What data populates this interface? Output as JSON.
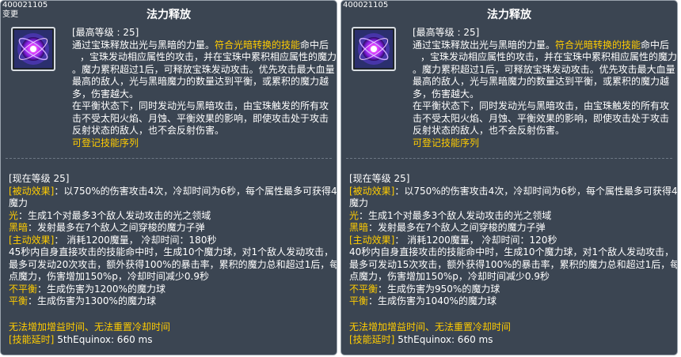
{
  "left": {
    "skill_id": "400021105",
    "changed_label": "变更",
    "title": "法力释放",
    "icon": "mana-orb-icon",
    "desc": {
      "max_level": "[最高等级 : 25]",
      "p1_a": "通过宝珠释放出光与黑暗的力量。",
      "p1_hl": "符合光暗转换的技能",
      "p1_b": "命中后",
      "l2": "，宝珠发动相应属性的攻击，并在宝珠中累积相应属性的魔力",
      "l3": "。魔力累积超过1后，可释放宝珠发动攻击。优先攻击最大血量",
      "l4": "最高的敌人，光与黑暗魔力的数量达到平衡，或累积的魔力越",
      "l5": "多，伤害越大。",
      "l6": "在平衡状态下，同时发动光与黑暗攻击，由宝珠触发的所有攻",
      "l7": "击不受太阳火焰、月蚀、平衡效果的影响，即使攻击处于攻击",
      "l8": "反射状态的敌人，也不会反射伤害。",
      "l9": "可登记技能序列"
    },
    "current": {
      "level": "[现在等级 25]",
      "passive_label": "[被动效果]",
      "passive_text": "：以750%的伤害攻击4次，冷却时间为6秒，每个属性最多可获得4",
      "passive_cont": "魔力",
      "light_label": "光",
      "light_text": "：生成1个对最多3个敌人发动攻击的光之领域",
      "dark_label": "黑暗",
      "dark_text": "：发射最多在7个敌人之间穿梭的魔力子弹",
      "active_label": "[主动效果]",
      "active_text": "： 消耗1200魔量， 冷却时间：180秒",
      "a1": "45秒内自身直接攻击的技能命中时，生成10个魔力球，对1个敌人发动攻击，",
      "a2": "最多可发动20次攻击，额外获得100%的暴击率，累积的魔力总和超过1后，每",
      "a3": "点魔力，伤害增加150%p，冷却时间减少0.9秒",
      "unbalanced_label": "不平衡",
      "unbalanced_text": "：生成伤害为1200%的魔力球",
      "balanced_label": "平衡",
      "balanced_text": "：生成伤害为1300%的魔力球"
    },
    "bottom": {
      "note": "无法增加增益时间、无法重置冷却时间",
      "delay_label": "[技能延时]",
      "delay_text": " 5thEquinox: 660 ms"
    }
  },
  "right": {
    "skill_id": "400021105",
    "title": "法力释放",
    "icon": "mana-orb-icon",
    "desc": {
      "max_level": "[最高等级 : 25]",
      "p1_a": "通过宝珠释放出光与黑暗的力量。",
      "p1_hl": "符合光暗转换的技能",
      "p1_b": "命中后",
      "l2": "，宝珠发动相应属性的攻击，并在宝珠中累积相应属性的魔力",
      "l3": "。魔力累积超过1后，可释放宝珠发动攻击。优先攻击最大血量",
      "l4": "最高的敌人，光与黑暗魔力的数量达到平衡，或累积的魔力越",
      "l5": "多，伤害越大。",
      "l6": "在平衡状态下，同时发动光与黑暗攻击，由宝珠触发的所有攻",
      "l7": "击不受太阳火焰、月蚀、平衡效果的影响，即使攻击处于攻击",
      "l8": "反射状态的敌人，也不会反射伤害。",
      "l9": "可登记技能序列"
    },
    "current": {
      "level": "[现在等级 25]",
      "passive_label": "[被动效果]",
      "passive_text": "：以750%的伤害攻击4次，冷却时间为6秒，每个属性最多可获得4",
      "passive_cont": "魔力",
      "light_label": "光",
      "light_text": "：生成1个对最多3个敌人发动攻击的光之领域",
      "dark_label": "黑暗",
      "dark_text": "：发射最多在7个敌人之间穿梭的魔力子弹",
      "active_label": "[主动效果]",
      "active_text": "： 消耗1200魔量， 冷却时间：120秒",
      "a1": "40秒内自身直接攻击的技能命中时，生成10个魔力球，对1个敌人发动攻击，",
      "a2": "最多可发动15次攻击，额外获得100%的暴击率，累积的魔力总和超过1后，每",
      "a3": "点魔力，伤害增加150%p，冷却时间减少0.9秒",
      "unbalanced_label": "不平衡",
      "unbalanced_text": "：生成伤害为950%的魔力球",
      "balanced_label": "平衡",
      "balanced_text": "：生成伤害为1040%的魔力球"
    },
    "bottom": {
      "note": "无法增加增益时间、无法重置冷却时间",
      "delay_label": "[技能延时]",
      "delay_text": " 5thEquinox: 660 ms"
    }
  },
  "colors": {
    "panel_bg": "#3b4552",
    "highlight": "#ffcc00",
    "text": "#ffffff"
  }
}
